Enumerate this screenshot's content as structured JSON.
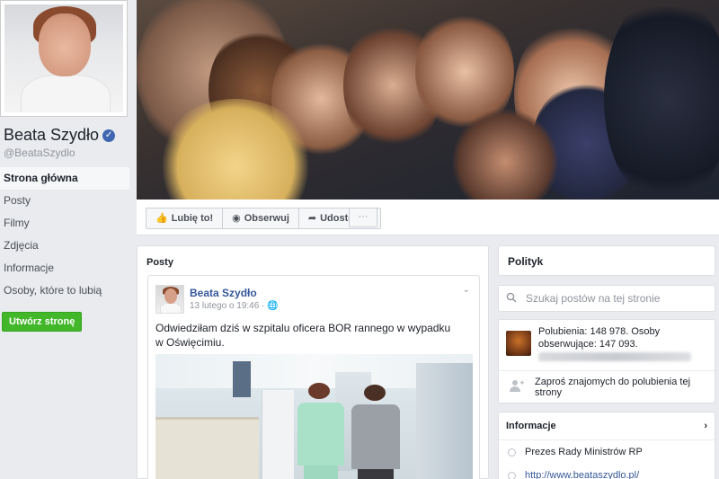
{
  "profile": {
    "name": "Beata Szydło",
    "handle": "@BeataSzydlo"
  },
  "nav": {
    "items": [
      {
        "label": "Strona główna",
        "active": true
      },
      {
        "label": "Posty"
      },
      {
        "label": "Filmy"
      },
      {
        "label": "Zdjęcia"
      },
      {
        "label": "Informacje"
      },
      {
        "label": "Osoby, które to lubią"
      }
    ]
  },
  "create_page": "Utwórz stronę",
  "actions": {
    "like": "Lubię to!",
    "follow": "Obserwuj",
    "share": "Udostępnij",
    "more": "···"
  },
  "posts": {
    "title": "Posty",
    "post": {
      "author": "Beata Szydło",
      "date": "13 lutego o 19:46 · ",
      "text": "Odwiedziłam dziś w szpitalu oficera BOR rannego w wypadku w Oświęcimiu."
    }
  },
  "sidebar": {
    "category": "Polityk",
    "search_placeholder": "Szukaj postów na tej stronie",
    "likes_text": "Polubienia: 148 978. Osoby obserwujące: 147 093.",
    "invite": "Zaproś znajomych do polubienia tej strony",
    "info_title": "Informacje",
    "info_position": "Prezes Rady Ministrów RP",
    "info_website": "http://www.beataszydlo.pl/"
  },
  "colors": {
    "brand": "#4267b2",
    "link": "#365899",
    "green": "#42b72a"
  }
}
